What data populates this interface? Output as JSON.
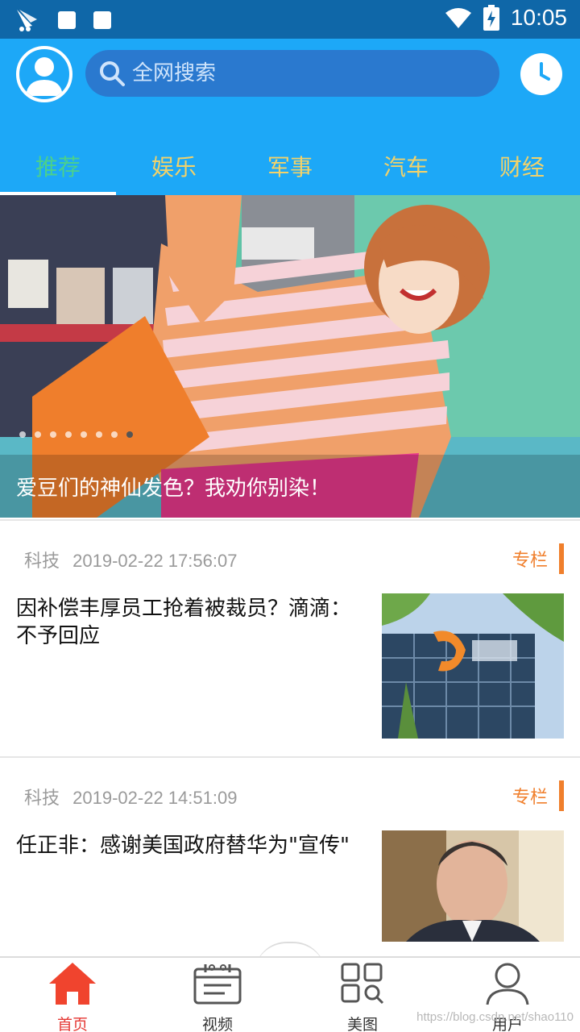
{
  "status_bar": {
    "time": "10:05",
    "icons": [
      "app-icon",
      "square-notification-icon",
      "square-notification-icon",
      "wifi-icon",
      "battery-charging-icon"
    ]
  },
  "header": {
    "search_placeholder": "全网搜索",
    "icons": [
      "avatar-icon",
      "search-icon",
      "clock-icon"
    ],
    "colors": {
      "header_bg": "#1da8f7",
      "search_bg": "#2a79cf",
      "status_bg": "#0f67a8"
    }
  },
  "tabs": [
    {
      "label": "推荐",
      "active": true
    },
    {
      "label": "娱乐",
      "active": false
    },
    {
      "label": "军事",
      "active": false
    },
    {
      "label": "汽车",
      "active": false
    },
    {
      "label": "财经",
      "active": false
    }
  ],
  "tab_colors": {
    "active": "#4bd08c",
    "inactive": "#f2d26a"
  },
  "banner": {
    "caption": "爱豆们的神仙发色？我劝你别染！",
    "indicator_count": 8,
    "active_indicator": 8
  },
  "news": [
    {
      "category": "科技",
      "time": "2019-02-22 17:56:07",
      "tag": "专栏",
      "title": "因补偿丰厚员工抢着被裁员？滴滴：不予回应"
    },
    {
      "category": "科技",
      "time": "2019-02-22 14:51:09",
      "tag": "专栏",
      "title": "任正非：感谢美国政府替华为\"宣传\""
    }
  ],
  "bottom_nav": [
    {
      "label": "首页",
      "icon": "home-icon",
      "active": true
    },
    {
      "label": "视频",
      "icon": "video-calendar-icon",
      "active": false
    },
    {
      "label": "美图",
      "icon": "grid-search-icon",
      "active": false
    },
    {
      "label": "用户",
      "icon": "user-icon",
      "active": false
    }
  ],
  "accent_colors": {
    "tag": "#f07f2c",
    "nav_active": "#e53935"
  },
  "watermark": "https://blog.csdn.net/shao110"
}
